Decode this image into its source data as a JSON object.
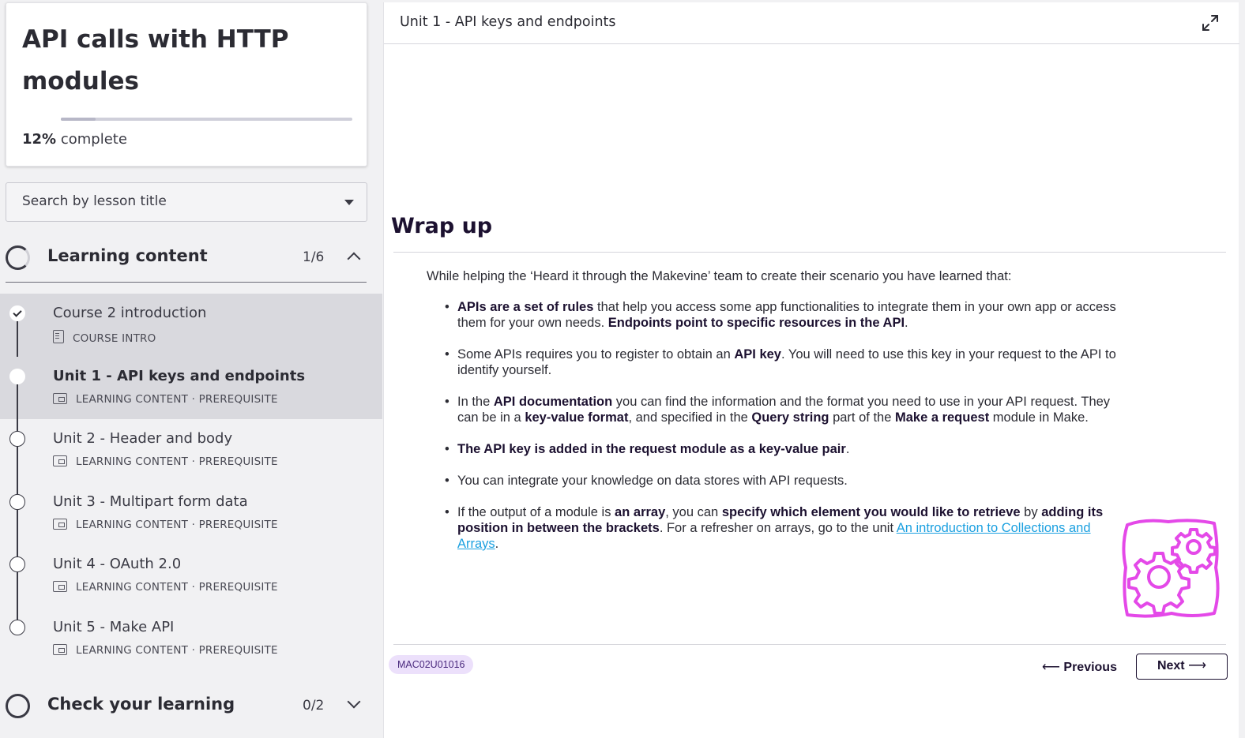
{
  "course": {
    "title": "API calls with HTTP modules",
    "progress_percent": 12,
    "progress_value": "12%",
    "progress_suffix": "complete"
  },
  "search": {
    "placeholder": "Search by lesson title"
  },
  "sections": [
    {
      "title": "Learning content",
      "count": "1/6",
      "expanded": true
    },
    {
      "title": "Check your learning",
      "count": "0/2",
      "expanded": false
    }
  ],
  "lessons": [
    {
      "title": "Course 2 introduction",
      "type": "COURSE INTRO",
      "tag": "",
      "state": "done"
    },
    {
      "title": "Unit 1 - API keys and endpoints",
      "type": "LEARNING CONTENT",
      "tag": "PREREQUISITE",
      "state": "current"
    },
    {
      "title": "Unit 2 - Header and body",
      "type": "LEARNING CONTENT",
      "tag": "PREREQUISITE",
      "state": "todo"
    },
    {
      "title": "Unit 3 - Multipart form data",
      "type": "LEARNING CONTENT",
      "tag": "PREREQUISITE",
      "state": "todo"
    },
    {
      "title": "Unit 4 - OAuth 2.0",
      "type": "LEARNING CONTENT",
      "tag": "PREREQUISITE",
      "state": "todo"
    },
    {
      "title": "Unit 5 - Make API",
      "type": "LEARNING CONTENT",
      "tag": "PREREQUISITE",
      "state": "todo"
    }
  ],
  "main": {
    "unit_title": "Unit 1 - API keys and endpoints",
    "heading": "Wrap up",
    "intro": "While helping the ‘Heard it through the Makevine’ team to create their scenario you have learned that:",
    "points": [
      [
        {
          "b": "APIs are a set of rules"
        },
        {
          "t": " that help you access some app functionalities to integrate them in your own app or access them for your own needs. "
        },
        {
          "b": "Endpoints point to specific resources in the API"
        },
        {
          "t": "."
        }
      ],
      [
        {
          "t": "Some APIs requires you to register to obtain an "
        },
        {
          "b": "API key"
        },
        {
          "t": ". You will need to use this key in your request to the API to identify yourself."
        }
      ],
      [
        {
          "t": "In the "
        },
        {
          "b": "API documentation"
        },
        {
          "t": " you can find the information and the format you need to use in your API request. They can be in a "
        },
        {
          "b": "key-value format"
        },
        {
          "t": ", and specified in the "
        },
        {
          "b": "Query string"
        },
        {
          "t": " part of the "
        },
        {
          "b": "Make a request"
        },
        {
          "t": " module in Make."
        }
      ],
      [
        {
          "b": "The API key is added in the request module as a key-value pair"
        },
        {
          "t": "."
        }
      ],
      [
        {
          "t": "You can integrate your knowledge on data stores with API requests."
        }
      ],
      [
        {
          "t": "If the output of a module is "
        },
        {
          "b": "an array"
        },
        {
          "t": ", you can "
        },
        {
          "b": "specify which element you would like to retrieve"
        },
        {
          "t": " by "
        },
        {
          "b": "adding its position in between the brackets"
        },
        {
          "t": ". For a refresher on arrays, go to the unit "
        },
        {
          "a": "An introduction to Collections and Arrays"
        },
        {
          "t": "."
        }
      ]
    ],
    "illustration_icon": "gears-icon",
    "code": "MAC02U01016",
    "prev_label": "Previous",
    "next_label": "Next"
  },
  "colors": {
    "accent": "#1c1130",
    "link": "#1ba0e0",
    "badge_bg": "#ece0fb",
    "gear": "#e449e8"
  }
}
